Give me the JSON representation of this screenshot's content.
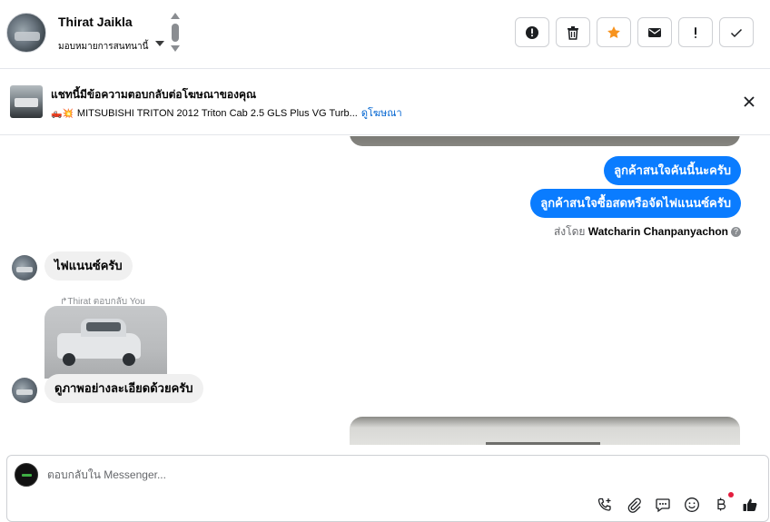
{
  "contact": {
    "name": "Thirat Jaikla",
    "assign_label": "มอบหมายการสนทนานี้"
  },
  "header_actions": [
    {
      "name": "report",
      "icon": "alert-circle-icon"
    },
    {
      "name": "delete",
      "icon": "trash-icon"
    },
    {
      "name": "star",
      "icon": "star-icon",
      "color": "#f7931e"
    },
    {
      "name": "mark-unread",
      "icon": "envelope-icon"
    },
    {
      "name": "spam",
      "icon": "exclamation-icon"
    },
    {
      "name": "done",
      "icon": "check-icon"
    }
  ],
  "ad_banner": {
    "title": "แชทนี้มีข้อความตอบกลับต่อโฆษณาของคุณ",
    "emoji": "🛻💥",
    "ad_text": "MITSUBISHI TRITON 2012 Triton Cab 2.5 GLS Plus VG Turb...",
    "link": "ดูโฆษณา"
  },
  "messages": {
    "outgoing_1": "ลูกค้าสนใจคันนี้นะครับ",
    "outgoing_2": "ลูกค้าสนใจซื้อสดหรือจัดไฟแนนซ์ครับ",
    "sent_by_prefix": "ส่งโดย",
    "sent_by_name": "Watcharin Chanpanyachon",
    "incoming_1": "ไฟแนนซ์ครับ",
    "reply_label": "↱Thirat ตอบกลับ You",
    "incoming_2": "ดูภาพอย่างละเอียดด้วยครับ"
  },
  "composer": {
    "placeholder": "ตอบกลับใน Messenger..."
  },
  "colors": {
    "accent": "#0a7cff",
    "link": "#0064d1",
    "star": "#f7931e"
  }
}
